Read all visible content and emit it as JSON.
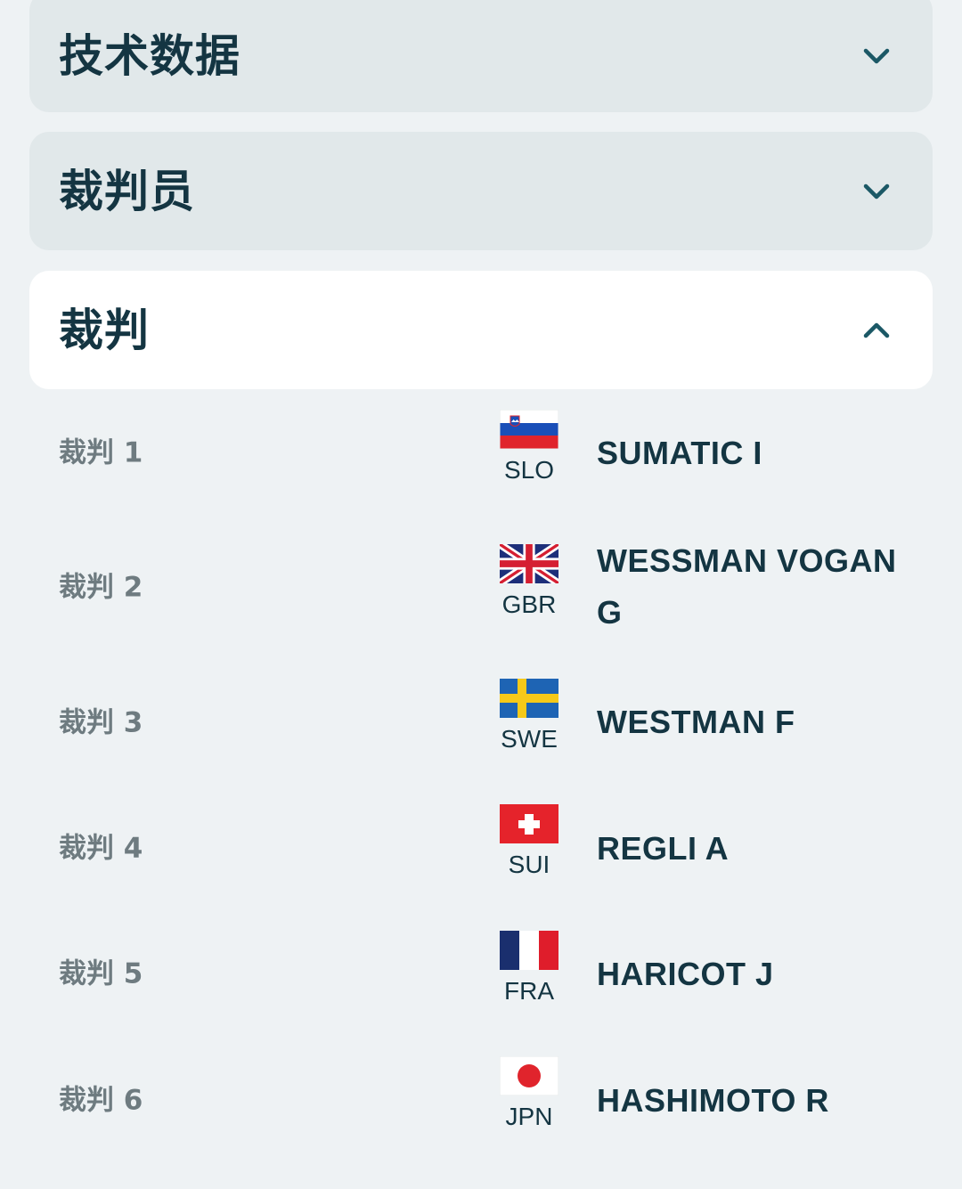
{
  "accordions": [
    {
      "title": "技术数据",
      "expanded": false,
      "icon": "chevron-down-icon"
    },
    {
      "title": "裁判员",
      "expanded": false,
      "icon": "chevron-down-icon"
    },
    {
      "title": "裁判",
      "expanded": true,
      "icon": "chevron-up-icon"
    }
  ],
  "judges": [
    {
      "label": "裁判 1",
      "country_code": "SLO",
      "flag": "slovenia-flag-icon",
      "name": "SUMATIC I"
    },
    {
      "label": "裁判 2",
      "country_code": "GBR",
      "flag": "uk-flag-icon",
      "name": "WESSMAN VOGAN G"
    },
    {
      "label": "裁判 3",
      "country_code": "SWE",
      "flag": "sweden-flag-icon",
      "name": "WESTMAN F"
    },
    {
      "label": "裁判 4",
      "country_code": "SUI",
      "flag": "switzerland-flag-icon",
      "name": "REGLI A"
    },
    {
      "label": "裁判 5",
      "country_code": "FRA",
      "flag": "france-flag-icon",
      "name": "HARICOT J"
    },
    {
      "label": "裁判 6",
      "country_code": "JPN",
      "flag": "japan-flag-icon",
      "name": "HASHIMOTO R"
    }
  ],
  "colors": {
    "text_dark": "#143542",
    "label_grey": "#6e7b80",
    "panel_bg": "#e1e8ea",
    "page_bg": "#eef2f4"
  }
}
